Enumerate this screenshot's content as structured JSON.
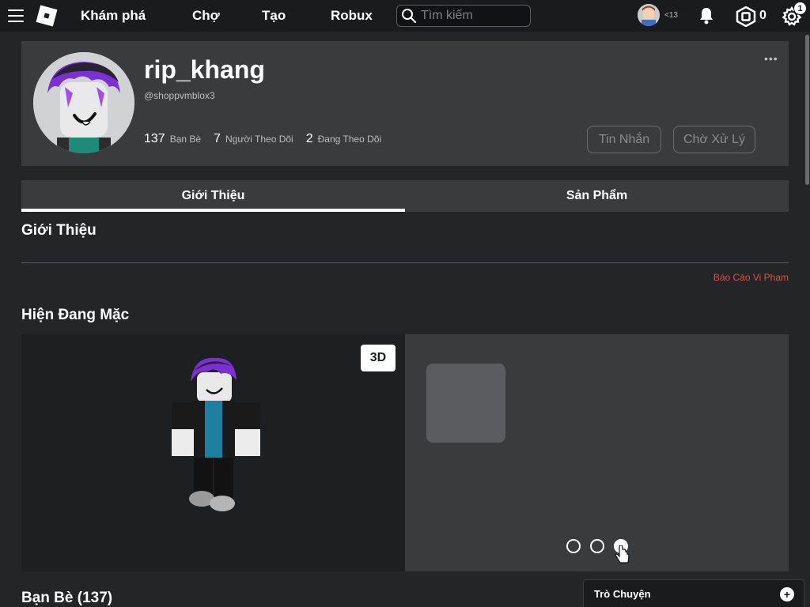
{
  "nav": {
    "links": [
      "Khám phá",
      "Chợ",
      "Tạo",
      "Robux"
    ],
    "search_placeholder": "Tìm kiếm",
    "age_label": "<13",
    "robux_count": "0",
    "settings_badge": "1"
  },
  "profile": {
    "username": "rip_khang",
    "handle": "@shoppvmblox3",
    "friends_count": "137",
    "friends_label": "Bạn Bè",
    "followers_count": "7",
    "followers_label": "Người Theo Dõi",
    "following_count": "2",
    "following_label": "Đang Theo Dõi",
    "more_label": "•••",
    "message_button": "Tin Nhắn",
    "pending_button": "Chờ Xử Lý"
  },
  "tabs": [
    "Giới Thiệu",
    "Sản Phẩm"
  ],
  "about": {
    "title": "Giới Thiệu",
    "report_link": "Báo Cáo Vi Phạm"
  },
  "wearing": {
    "title": "Hiện Đang Mặc",
    "view_3d_label": "3D",
    "pages": 3,
    "active_page": 3
  },
  "friends_section": {
    "title": "Bạn Bè (137)"
  },
  "chat": {
    "label": "Trò Chuyện"
  },
  "colors": {
    "background": "#232527",
    "panel": "#393b3d",
    "topbar": "#191b1d",
    "report_red": "#e54d42",
    "hair_purple": "#7b2fd6"
  }
}
